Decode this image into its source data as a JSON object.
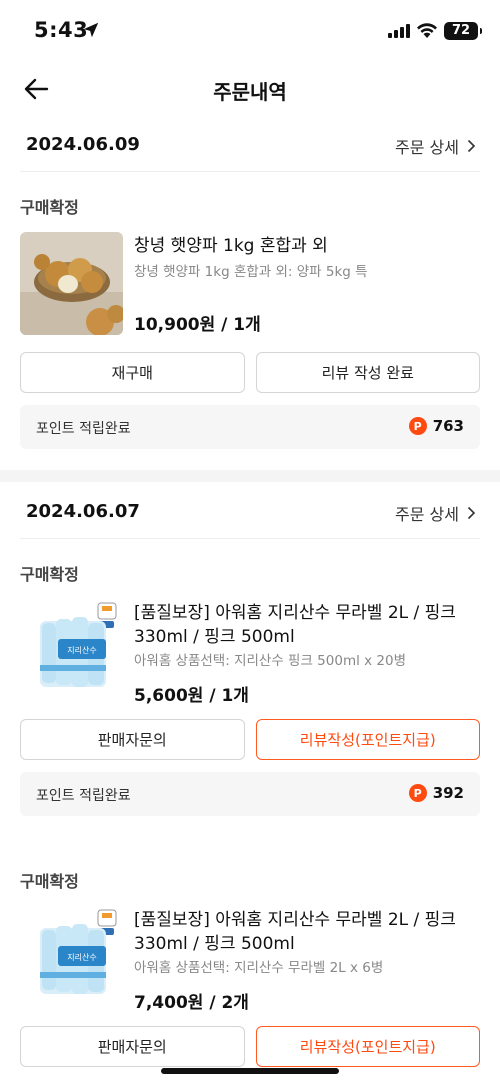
{
  "status_bar": {
    "time": "5:43",
    "battery": "72"
  },
  "header": {
    "title": "주문내역"
  },
  "detail_link": "주문 상세",
  "orders": [
    {
      "date": "2024.06.09",
      "items": [
        {
          "status": "구매확정",
          "name": "창녕 햇양파 1kg 혼합과 외",
          "option": "창녕 햇양파 1kg 혼합과 외: 양파 5kg 특",
          "price": "10,900원 / 1개",
          "buttons": [
            "재구매",
            "리뷰 작성 완료"
          ],
          "point_label": "포인트 적립완료",
          "points": "763"
        }
      ]
    },
    {
      "date": "2024.06.07",
      "items": [
        {
          "status": "구매확정",
          "name": "[품질보장] 아워홈 지리산수 무라벨 2L / 핑크 330ml / 핑크 500ml",
          "option": "아워홈 상품선택: 지리산수 핑크 500ml x 20병",
          "price": "5,600원 / 1개",
          "buttons": [
            "판매자문의",
            "리뷰작성(포인트지급)"
          ],
          "point_label": "포인트 적립완료",
          "points": "392"
        },
        {
          "status": "구매확정",
          "name": "[품질보장] 아워홈 지리산수 무라벨 2L / 핑크 330ml / 핑크 500ml",
          "option": "아워홈 상품선택: 지리산수 무라벨 2L x 6병",
          "price": "7,400원 / 2개",
          "buttons": [
            "판매자문의",
            "리뷰작성(포인트지급)"
          ]
        }
      ]
    }
  ],
  "point_badge": "P",
  "colors": {
    "accent": "#ff4a10",
    "muted": "#888888",
    "point_bg": "#f6f6f6"
  }
}
